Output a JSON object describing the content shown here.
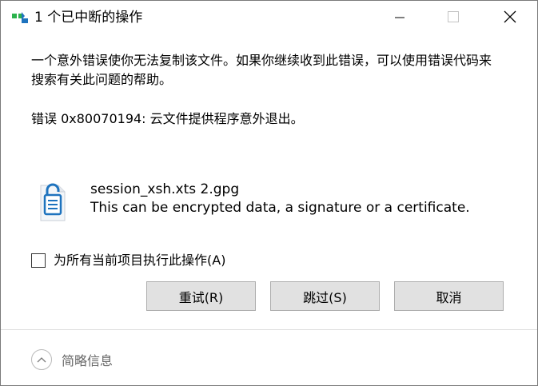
{
  "window": {
    "title": "1 个已中断的操作"
  },
  "message": {
    "text": "一个意外错误使你无法复制该文件。如果你继续收到此错误，可以使用错误代码来搜索有关此问题的帮助。",
    "error": "错误 0x80070194: 云文件提供程序意外退出。"
  },
  "file": {
    "name": "session_xsh.xts 2.gpg",
    "description": "This can be encrypted data, a signature or a certificate.",
    "icon": "encrypted-file-icon"
  },
  "apply_all": {
    "label": "为所有当前项目执行此操作(A)",
    "checked": false
  },
  "buttons": {
    "retry": "重试(R)",
    "skip": "跳过(S)",
    "cancel": "取消"
  },
  "footer": {
    "details_label": "简略信息",
    "details_icon": "chevron-up-icon"
  },
  "colors": {
    "button_bg": "#e1e1e1",
    "icon_blue": "#1e73be",
    "icon_green": "#2bb24c",
    "muted_text": "#666666"
  }
}
